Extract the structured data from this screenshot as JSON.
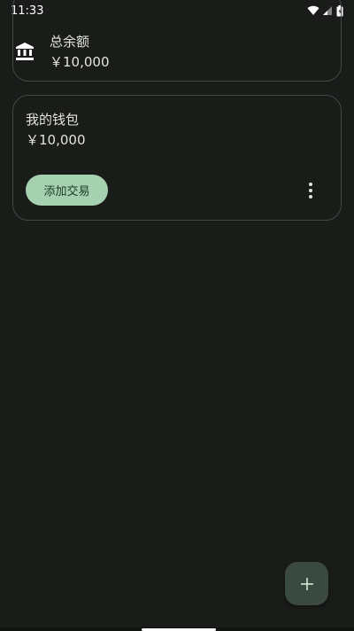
{
  "status_bar": {
    "time": "11:33",
    "icons": [
      "wifi-icon",
      "signal-icon",
      "battery-icon"
    ]
  },
  "total_card": {
    "icon": "bank-icon",
    "title": "总余额",
    "amount": "￥10,000"
  },
  "wallet_card": {
    "name": "我的钱包",
    "amount": "￥10,000",
    "add_transaction_label": "添加交易",
    "more_icon": "more-vert-icon"
  },
  "fab": {
    "icon": "plus-icon"
  },
  "colors": {
    "background": "#1a1c1a",
    "card_border": "#444844",
    "primary_button": "#a6d1b0",
    "fab": "#3b4a40",
    "text": "#e1e3df"
  }
}
